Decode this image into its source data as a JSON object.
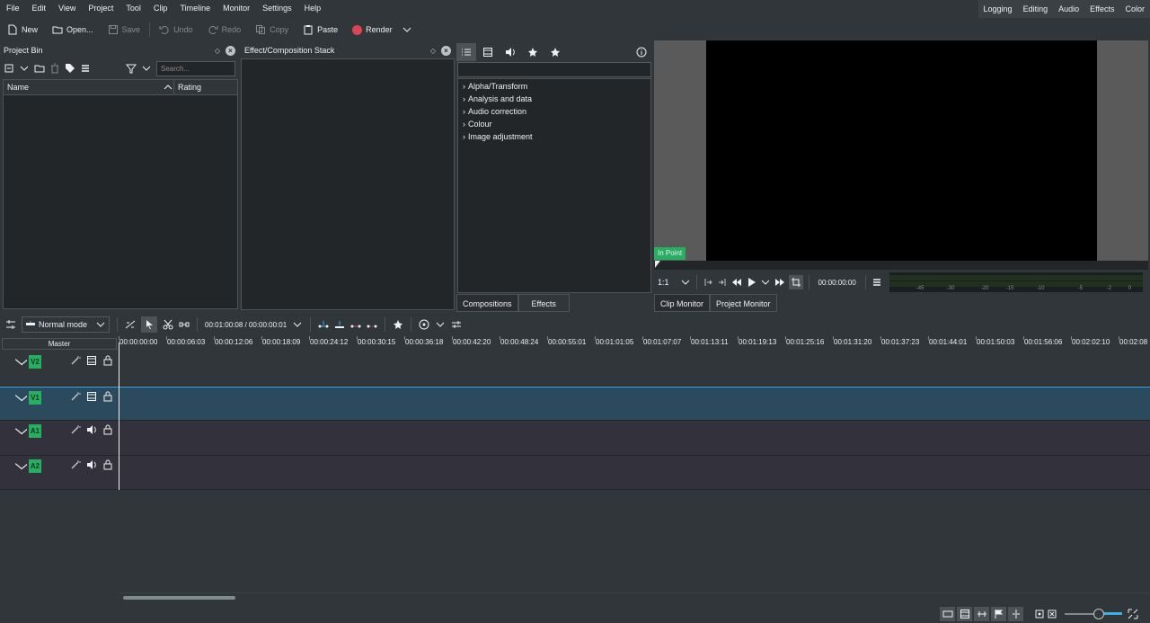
{
  "menu": [
    "File",
    "Edit",
    "View",
    "Project",
    "Tool",
    "Clip",
    "Timeline",
    "Monitor",
    "Settings",
    "Help"
  ],
  "layouts": [
    "Logging",
    "Editing",
    "Audio",
    "Effects",
    "Color"
  ],
  "toolbar": {
    "new": "New",
    "open": "Open...",
    "save": "Save",
    "undo": "Undo",
    "redo": "Redo",
    "copy": "Copy",
    "paste": "Paste",
    "render": "Render"
  },
  "project_bin": {
    "title": "Project Bin",
    "search_placeholder": "Search...",
    "col_name": "Name",
    "col_rating": "Rating"
  },
  "effect_stack": {
    "title": "Effect/Composition Stack"
  },
  "effects_panel": {
    "categories": [
      "Alpha/Transform",
      "Analysis and data",
      "Audio correction",
      "Colour",
      "Image adjustment"
    ],
    "tabs": [
      "Compositions",
      "Effects"
    ]
  },
  "monitor": {
    "in_point": "In Point",
    "zoom": "1:1",
    "timecode": "00:00:00:00",
    "db_scale": [
      "-45",
      "-30",
      "-20",
      "-15",
      "-10",
      "-5",
      "-2",
      "0"
    ],
    "tabs": [
      "Clip Monitor",
      "Project Monitor"
    ]
  },
  "timeline_toolbar": {
    "mode": "Normal mode",
    "position": "00:01:00:08 / 00:00:00:01"
  },
  "timeline": {
    "master": "Master",
    "ruler": [
      "00:00:00:00",
      "00:00:06:03",
      "00:00:12:06",
      "00:00:18:09",
      "00:00:24:12",
      "00:00:30:15",
      "00:00:36:18",
      "00:00:42:20",
      "00:00:48:24",
      "00:00:55:01",
      "00:01:01:05",
      "00:01:07:07",
      "00:01:13:11",
      "00:01:19:13",
      "00:01:25:16",
      "00:01:31:20",
      "00:01:37:23",
      "00:01:44:01",
      "00:01:50:03",
      "00:01:56:06",
      "00:02:02:10",
      "00:02:08"
    ],
    "tracks": [
      {
        "tag": "V2",
        "type": "video"
      },
      {
        "tag": "V1",
        "type": "video"
      },
      {
        "tag": "A1",
        "type": "audio"
      },
      {
        "tag": "A2",
        "type": "audio"
      }
    ]
  },
  "colors": {
    "accent": "#3daee9",
    "record": "#da4453",
    "track_tag": "#27ae60",
    "selected_track": "#2c4a5e"
  }
}
